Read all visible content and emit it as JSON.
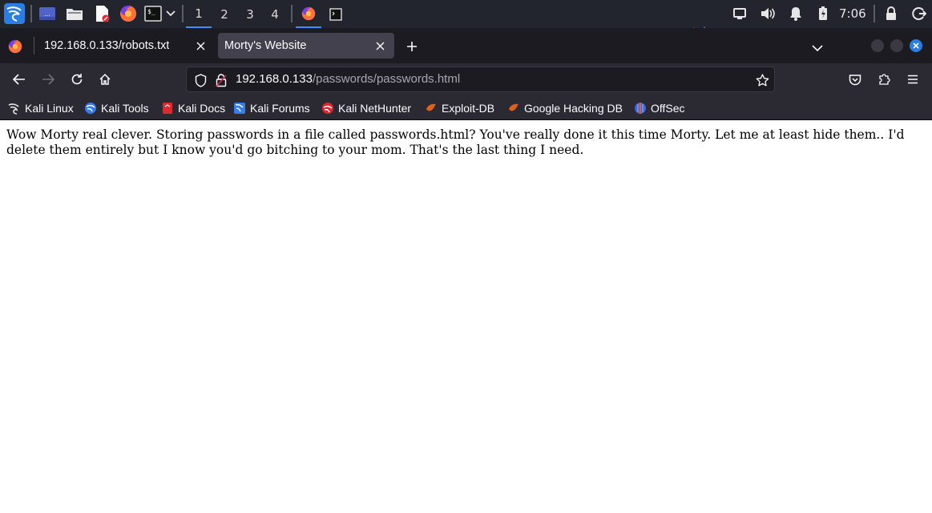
{
  "panel": {
    "workspaces": [
      "1",
      "2",
      "3",
      "4"
    ],
    "active_workspace": "1",
    "clock": "7:06",
    "icons": [
      "kali-menu-icon",
      "show-desktop-icon",
      "file-manager-icon",
      "text-editor-icon",
      "firefox-icon",
      "terminal-icon",
      "network-icon",
      "volume-icon",
      "notifications-icon",
      "battery-icon",
      "lock-icon",
      "logout-icon"
    ]
  },
  "tabs": [
    {
      "title": "192.168.0.133/robots.txt",
      "favicon": "firefox-icon",
      "selected": false
    },
    {
      "title": "Morty's Website",
      "selected": true
    }
  ],
  "url": {
    "host": "192.168.0.133",
    "path": "/passwords/passwords.html"
  },
  "bookmarks": [
    {
      "label": "Kali Linux",
      "icon": "kali-dragon-icon",
      "color": "#000000"
    },
    {
      "label": "Kali Tools",
      "icon": "kali-tools-icon",
      "color": "#367bf0"
    },
    {
      "label": "Kali Docs",
      "icon": "kali-docs-icon",
      "color": "#e0282e"
    },
    {
      "label": "Kali Forums",
      "icon": "kali-forums-icon",
      "color": "#367bf0"
    },
    {
      "label": "Kali NetHunter",
      "icon": "kali-nethunter-icon",
      "color": "#e0282e"
    },
    {
      "label": "Exploit-DB",
      "icon": "exploit-db-icon",
      "color": "#e35f1c"
    },
    {
      "label": "Google Hacking DB",
      "icon": "ghdb-icon",
      "color": "#e35f1c"
    },
    {
      "label": "OffSec",
      "icon": "offsec-icon",
      "color": "#3f64d8"
    }
  ],
  "page": {
    "text": "Wow Morty real clever. Storing passwords in a file called passwords.html? You've really done it this time Morty. Let me at least hide them.. I'd delete them entirely but I know you'd go bitching to your mom. That's the last thing I need."
  }
}
